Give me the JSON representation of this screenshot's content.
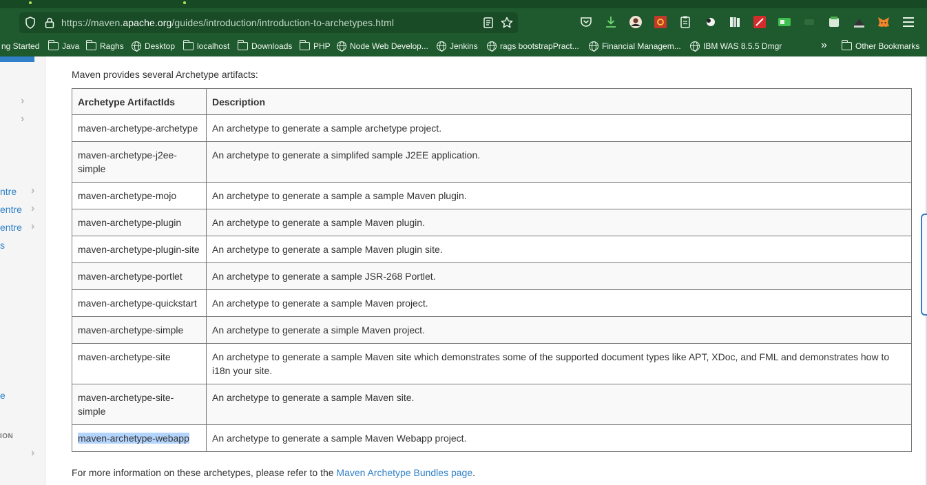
{
  "browser": {
    "url_prefix": "https://maven.",
    "url_domain": "apache.org",
    "url_path": "/guides/introduction/introduction-to-archetypes.html",
    "accent": "#1f5a2e"
  },
  "bookmarks": [
    {
      "label": "ng Started",
      "icon": "none"
    },
    {
      "label": "Java",
      "icon": "folder-icon"
    },
    {
      "label": "Raghs",
      "icon": "folder-icon"
    },
    {
      "label": "Desktop",
      "icon": "globe-icon"
    },
    {
      "label": "localhost",
      "icon": "folder-icon"
    },
    {
      "label": "Downloads",
      "icon": "folder-icon"
    },
    {
      "label": "PHP",
      "icon": "folder-icon"
    },
    {
      "label": "Node Web Develop...",
      "icon": "globe-icon"
    },
    {
      "label": "Jenkins",
      "icon": "globe-icon"
    },
    {
      "label": "rags bootstrapPract...",
      "icon": "globe-icon"
    },
    {
      "label": "Financial Managem...",
      "icon": "globe-icon"
    },
    {
      "label": "IBM WAS 8.5.5 Dmgr",
      "icon": "globe-icon"
    }
  ],
  "bookmarks_more": "»",
  "other_bookmarks": "Other Bookmarks",
  "sidebar": {
    "links": [
      "ntre",
      "entre",
      "entre",
      "s",
      "e"
    ],
    "section_label": "ION"
  },
  "main": {
    "intro": "Maven provides several Archetype artifacts:",
    "table": {
      "headers": [
        "Archetype ArtifactIds",
        "Description"
      ],
      "rows": [
        [
          "maven-archetype-archetype",
          "An archetype to generate a sample archetype project."
        ],
        [
          "maven-archetype-j2ee-simple",
          "An archetype to generate a simplifed sample J2EE application."
        ],
        [
          "maven-archetype-mojo",
          "An archetype to generate a sample a sample Maven plugin."
        ],
        [
          "maven-archetype-plugin",
          "An archetype to generate a sample Maven plugin."
        ],
        [
          "maven-archetype-plugin-site",
          "An archetype to generate a sample Maven plugin site."
        ],
        [
          "maven-archetype-portlet",
          "An archetype to generate a sample JSR-268 Portlet."
        ],
        [
          "maven-archetype-quickstart",
          "An archetype to generate a sample Maven project."
        ],
        [
          "maven-archetype-simple",
          "An archetype to generate a simple Maven project."
        ],
        [
          "maven-archetype-site",
          "An archetype to generate a sample Maven site which demonstrates some of the supported document types like APT, XDoc, and FML and demonstrates how to i18n your site."
        ],
        [
          "maven-archetype-site-simple",
          "An archetype to generate a sample Maven site."
        ],
        [
          "maven-archetype-webapp",
          "An archetype to generate a sample Maven Webapp project."
        ]
      ],
      "highlighted_row": 10
    },
    "footer_text": "For more information on these archetypes, please refer to the ",
    "footer_link": "Maven Archetype Bundles page",
    "footer_end": "."
  }
}
